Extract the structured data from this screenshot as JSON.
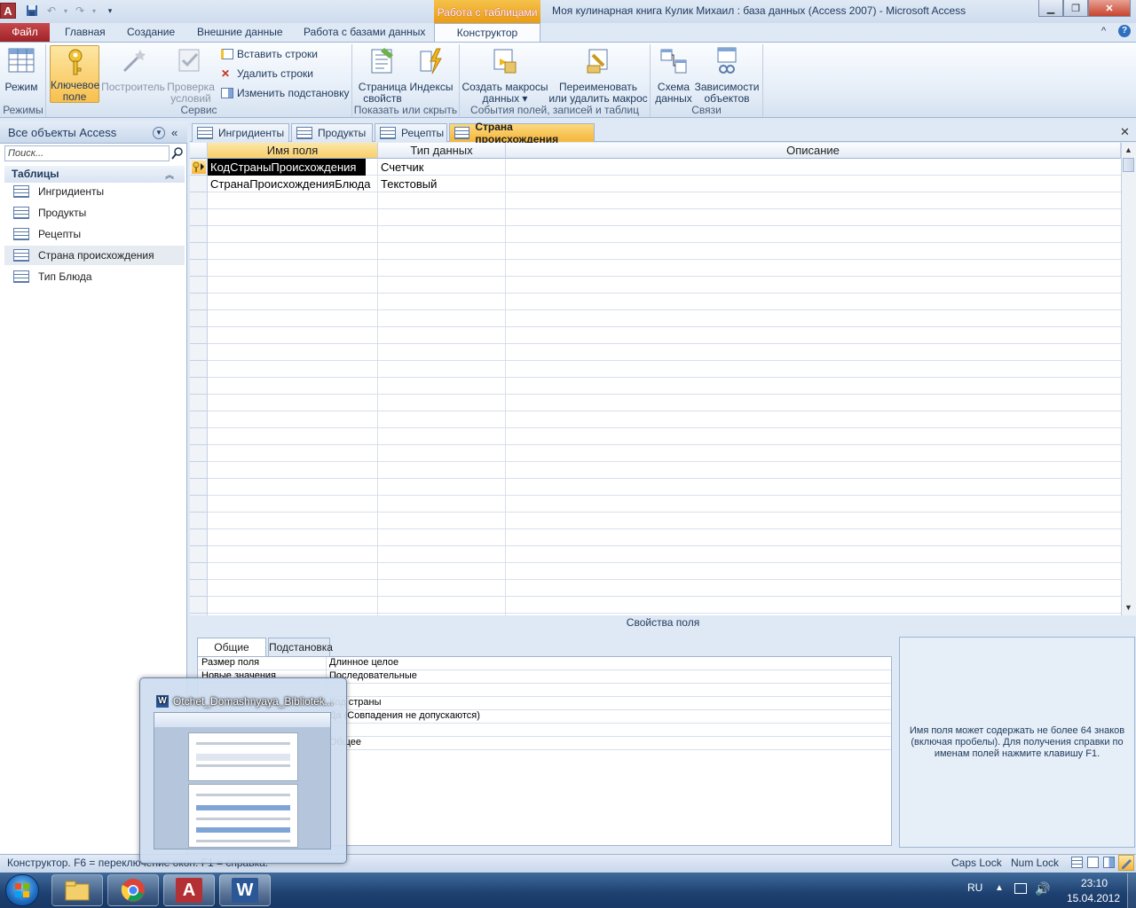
{
  "window": {
    "title": "Моя кулинарная книга Кулик Михаил : база данных (Access 2007)  -  Microsoft Access",
    "context_tab": "Работа с таблицами",
    "app_logo": "A"
  },
  "ribbon_tabs": [
    "Файл",
    "Главная",
    "Создание",
    "Внешние данные",
    "Работа с базами данных",
    "Конструктор"
  ],
  "ribbon": {
    "mode_label": "Режим",
    "key_label": [
      "Ключевое",
      "поле"
    ],
    "builder_label": "Построитель",
    "check_label": [
      "Проверка",
      "условий"
    ],
    "insert_rows": "Вставить строки",
    "delete_rows": "Удалить строки",
    "change_lookup": "Изменить подстановку",
    "property_sheet": [
      "Страница",
      "свойств"
    ],
    "indexes": "Индексы",
    "create_macros": [
      "Создать макросы",
      "данных ▾"
    ],
    "rename_macro": [
      "Переименовать",
      "или удалить макрос"
    ],
    "relationships": [
      "Схема",
      "данных"
    ],
    "dependencies": [
      "Зависимости",
      "объектов"
    ],
    "groups": {
      "modes": "Режимы",
      "service": "Сервис",
      "show_hide": "Показать или скрыть",
      "events": "События полей, записей и таблиц",
      "links": "Связи"
    }
  },
  "nav": {
    "header": "Все объекты Access",
    "search_placeholder": "Поиск...",
    "category": "Таблицы",
    "items": [
      "Ингридиенты",
      "Продукты",
      "Рецепты",
      "Страна происхождения",
      "Тип Блюда"
    ]
  },
  "doc_tabs": [
    "Ингридиенты",
    "Продукты",
    "Рецепты",
    "Страна происхождения"
  ],
  "design_grid": {
    "headers": [
      "Имя поля",
      "Тип данных",
      "Описание"
    ],
    "rows": [
      {
        "name": "КодСтраныПроисхождения",
        "type": "Счетчик",
        "desc": ""
      },
      {
        "name": "СтранаПроисхожденияБлюда",
        "type": "Текстовый",
        "desc": ""
      }
    ]
  },
  "field_props": {
    "section_label": "Свойства поля",
    "tabs": [
      "Общие",
      "Подстановка"
    ],
    "rows": [
      {
        "name": "Размер поля",
        "value": "Длинное целое"
      },
      {
        "name": "Новые значения",
        "value": "Последовательные"
      },
      {
        "name": "",
        "value": ""
      },
      {
        "name": "",
        "value": "Код страны"
      },
      {
        "name": "",
        "value": "Да (Совпадения не допускаются)"
      },
      {
        "name": "",
        "value": ""
      },
      {
        "name": "",
        "value": "Общее"
      }
    ],
    "help": "Имя поля может содержать не более 64 знаков (включая пробелы). Для получения справки по именам полей нажмите клавишу F1."
  },
  "status": {
    "left": "Конструктор.  F6 = переключение окон.  F1 = справка.",
    "caps": "Caps Lock",
    "num": "Num Lock"
  },
  "taskbar": {
    "lang": "RU",
    "time": "23:10",
    "date": "15.04.2012",
    "thumb_title": "Otchet_Domashnyaya_Bibliotek..."
  }
}
